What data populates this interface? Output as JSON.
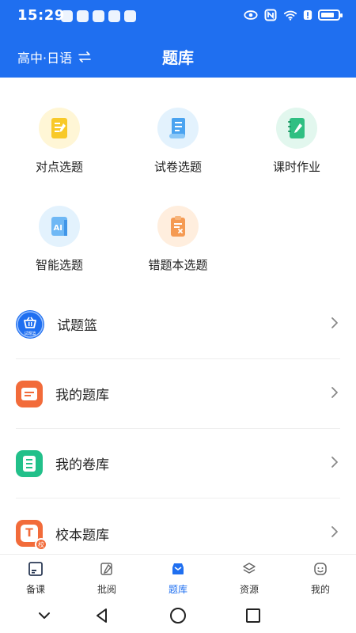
{
  "status": {
    "time": "15:29",
    "battery_level": 0.8
  },
  "header": {
    "grade_select": "高中·日语",
    "title": "题库"
  },
  "tiles": [
    {
      "label": "对点选题",
      "icon": "pencil-note-icon",
      "bg": "#fff6d6",
      "color": "#f5c518"
    },
    {
      "label": "试卷选题",
      "icon": "paper-scroll-icon",
      "bg": "#e3f2fd",
      "color": "#4aa3f0"
    },
    {
      "label": "课时作业",
      "icon": "notebook-edit-icon",
      "bg": "#e2f7ee",
      "color": "#2fbf82"
    },
    {
      "label": "智能选题",
      "icon": "ai-icon",
      "bg": "#e3f2fd",
      "color": "#5aaef2"
    },
    {
      "label": "错题本选题",
      "icon": "wrong-clipboard-icon",
      "bg": "#ffeede",
      "color": "#f59a52"
    }
  ],
  "list": [
    {
      "label": "试题篮",
      "icon": "basket-icon",
      "icon_caption": "试题篮",
      "color": "#1f6ff0"
    },
    {
      "label": "我的题库",
      "icon": "folder-lines-icon",
      "color": "#f26b3a"
    },
    {
      "label": "我的卷库",
      "icon": "document-list-icon",
      "color": "#22c08a"
    },
    {
      "label": "校本题库",
      "icon": "school-bank-icon",
      "letter": "T",
      "badge": "校",
      "color": "#f26b3a"
    }
  ],
  "tabs": [
    {
      "label": "备课",
      "icon": "lesson-prep-icon"
    },
    {
      "label": "批阅",
      "icon": "review-edit-icon"
    },
    {
      "label": "题库",
      "icon": "question-bank-icon",
      "active": true
    },
    {
      "label": "资源",
      "icon": "layers-icon"
    },
    {
      "label": "我的",
      "icon": "smiley-profile-icon"
    }
  ],
  "colors": {
    "primary": "#1f6ff0",
    "text": "#222222",
    "divider": "#eeeeee"
  }
}
